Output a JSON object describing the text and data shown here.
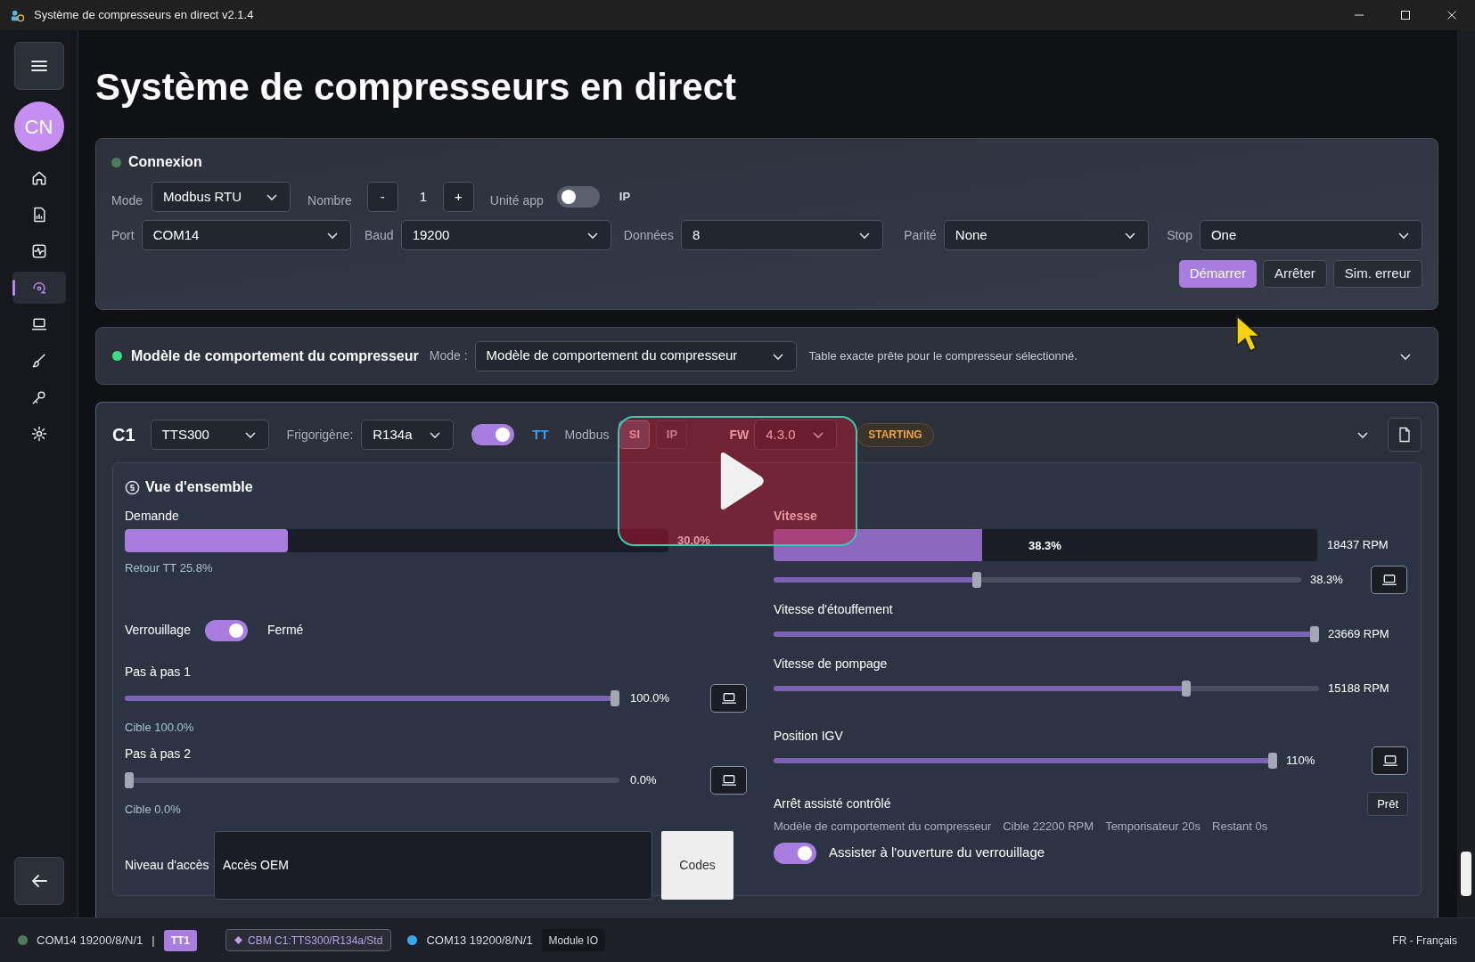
{
  "window": {
    "title": "Système de compresseurs en direct v2.1.4"
  },
  "sidebar": {
    "menu": {
      "kind": "menu"
    },
    "avatar": "CN",
    "items": [
      {
        "kind": "home",
        "selected": false
      },
      {
        "kind": "report",
        "selected": false
      },
      {
        "kind": "pulse",
        "selected": false
      },
      {
        "kind": "gauge",
        "selected": true
      },
      {
        "kind": "laptop",
        "selected": false
      },
      {
        "kind": "brush",
        "selected": false
      },
      {
        "kind": "key",
        "selected": false
      },
      {
        "kind": "settings",
        "selected": false
      }
    ],
    "back": {
      "kind": "back"
    }
  },
  "page_title": "Système de compresseurs en direct",
  "connexion": {
    "title": "Connexion",
    "color": "#4f7a5c",
    "mode": {
      "label": "Mode",
      "value": "Modbus RTU"
    },
    "nombre": {
      "label": "Nombre",
      "minus": "-",
      "value": "1",
      "plus": "+"
    },
    "unite_app": {
      "label": "Unité app",
      "on": false,
      "after": "IP"
    },
    "serial": [
      {
        "label": "Port",
        "value": "COM14"
      },
      {
        "label": "Baud",
        "value": "19200"
      },
      {
        "label": "Données",
        "value": "8"
      },
      {
        "label": "Parité",
        "value": "None"
      },
      {
        "label": "Stop",
        "value": "One"
      }
    ],
    "buttons": [
      {
        "label": "Démarrer",
        "primary": true
      },
      {
        "label": "Arrêter",
        "primary": false
      },
      {
        "label": "Sim. erreur",
        "primary": false
      }
    ]
  },
  "behavior_model": {
    "title": "Modèle de comportement du compresseur",
    "color": "#3ddc84",
    "mode_label": "Mode :",
    "mode_value": "Modèle de comportement du compresseur",
    "message": "Table exacte prête pour le compresseur sélectionné."
  },
  "compressor": {
    "id": "C1",
    "model": "TTS300",
    "refrigerant_label": "Frigorigène:",
    "refrigerant": "R134a",
    "enabled": true,
    "tt": "TT",
    "modbus_label": "Modbus",
    "modbus": [
      {
        "label": "SI",
        "selected": true
      },
      {
        "label": "IP",
        "selected": false
      }
    ],
    "fw_label": "FW",
    "fw": "4.3.0",
    "status": "STARTING",
    "overview": {
      "title": "Vue d'ensemble",
      "demande": {
        "label": "Demande",
        "level": 0.3,
        "reading": "30.0%",
        "retour": "Retour TT 25.8%"
      },
      "vitesse": {
        "label": "Vitesse",
        "level": 0.383,
        "bar_text": "38.3%",
        "rpm": "18437 RPM",
        "slider": {
          "level": 0.383,
          "reading": "38.3%"
        }
      },
      "verrouillage": {
        "label": "Verrouillage",
        "on": true,
        "state": "Fermé"
      },
      "left_sliders": [
        {
          "label": "Pas à pas 1",
          "level": 1.0,
          "reading": "100.0%",
          "target": "Cible 100.0%"
        },
        {
          "label": "Pas à pas 2",
          "level": 0.0,
          "reading": "0.0%",
          "target": "Cible 0.0%"
        }
      ],
      "right_sliders": [
        {
          "label": "Vitesse d'étouffement",
          "level": 1.0,
          "reading": "23669 RPM",
          "button": false
        },
        {
          "label": "Vitesse de pompage",
          "level": 0.76,
          "reading": "15188 RPM",
          "button": false
        },
        {
          "label": "Position IGV",
          "level": 1.0,
          "reading": "110%",
          "button": true
        }
      ],
      "access": {
        "label": "Niveau d'accès",
        "value": "Accès OEM",
        "button": "Codes"
      },
      "assisted_stop": {
        "title": "Arrêt assisté contrôlé",
        "badge": "Prêt",
        "info": [
          "Modèle de comportement du compresseur",
          "Cible 22200 RPM",
          "Temporisateur 20s",
          "Restant 0s"
        ],
        "assist_on": true,
        "assist_label": "Assister à l'ouverture du verrouillage"
      }
    }
  },
  "status_bar": {
    "left": [
      {
        "kind": "port",
        "color": "#4f7a5c",
        "text": "COM14 19200/8/N/1"
      },
      {
        "kind": "sep",
        "text": "|"
      },
      {
        "kind": "tag",
        "text": "TT1"
      },
      {
        "kind": "chip",
        "text": "CBM C1:TTS300/R134a/Std"
      },
      {
        "kind": "port",
        "color": "#3aa8f0",
        "text": "COM13 19200/8/N/1"
      },
      {
        "kind": "label",
        "text": "Module IO"
      }
    ],
    "language": "FR - Français"
  }
}
